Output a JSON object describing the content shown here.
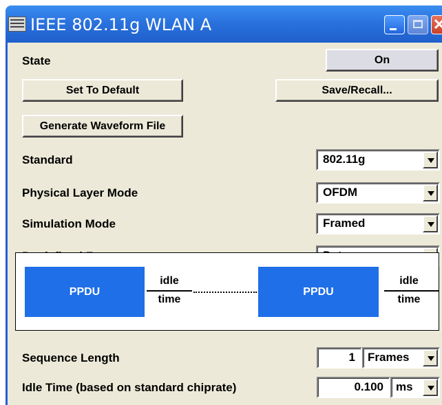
{
  "window": {
    "title": "IEEE 802.11g WLAN  A",
    "buttons": {
      "minimize": "minimize",
      "maximize": "maximize",
      "close": "✕"
    }
  },
  "state": {
    "label": "State",
    "value": "On"
  },
  "actions": {
    "set_default": "Set To Default",
    "save_recall": "Save/Recall...",
    "generate": "Generate Waveform File"
  },
  "settings": {
    "standard": {
      "label": "Standard",
      "value": "802.11g"
    },
    "phy_mode": {
      "label": "Physical Layer Mode",
      "value": "OFDM"
    },
    "sim_mode": {
      "label": "Simulation Mode",
      "value": "Framed"
    },
    "predef": {
      "label": "Predefined Frames",
      "value": "Data"
    }
  },
  "diagram": {
    "ppdu": "PPDU",
    "idle": "idle",
    "time": "time"
  },
  "sequence": {
    "label": "Sequence Length",
    "value": "1",
    "unit": "Frames"
  },
  "idle_time": {
    "label": "Idle Time (based on standard chiprate)",
    "value": "0.100",
    "unit": "ms"
  },
  "colors": {
    "title_blue": "#2a72de",
    "panel": "#ece9d8",
    "ppdu_blue": "#1f6fe8"
  }
}
